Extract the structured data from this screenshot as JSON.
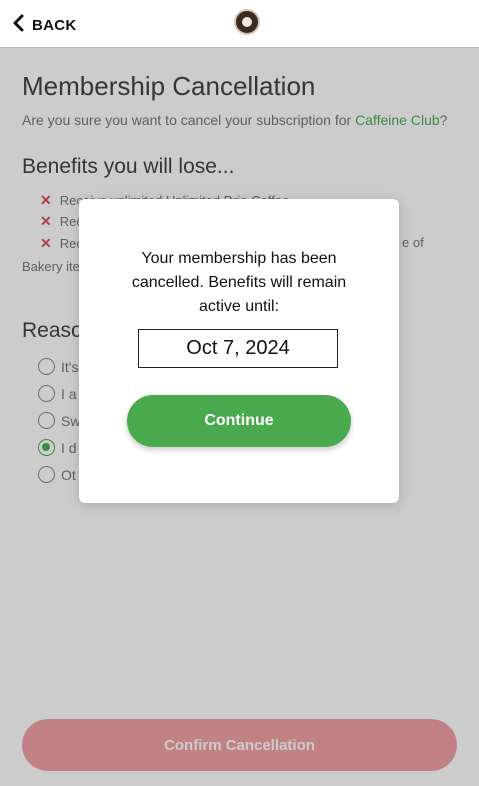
{
  "header": {
    "back_label": "BACK"
  },
  "page": {
    "title": "Membership Cancellation",
    "subtitle_prefix": "Are you sure you want to cancel your subscription for ",
    "club_name": "Caffeine Club",
    "subtitle_suffix": "?"
  },
  "benefits": {
    "heading": "Benefits you will lose...",
    "items": [
      "Receive unlimited Unlimited Drip Coffee",
      "Rec",
      "Rec"
    ],
    "item3_tail": "e of",
    "continuation": "Bakery ite"
  },
  "reasons": {
    "heading": "Reaso",
    "options": [
      {
        "label": "It's",
        "checked": false
      },
      {
        "label": "I a",
        "checked": false
      },
      {
        "label": "Sw",
        "checked": false
      },
      {
        "label": "I d",
        "checked": true
      },
      {
        "label": "Ot",
        "checked": false
      }
    ]
  },
  "footer": {
    "confirm_label": "Confirm Cancellation"
  },
  "modal": {
    "message": "Your membership has been cancelled. Benefits will remain active until:",
    "date": "Oct 7, 2024",
    "continue_label": "Continue"
  },
  "colors": {
    "accent_green": "#4caf50",
    "confirm_red": "#f3a3a6",
    "x_red": "#d9534f"
  },
  "icons": {
    "back": "chevron-left-icon",
    "logo": "coffee-logo-icon",
    "benefit": "x-mark-icon"
  }
}
